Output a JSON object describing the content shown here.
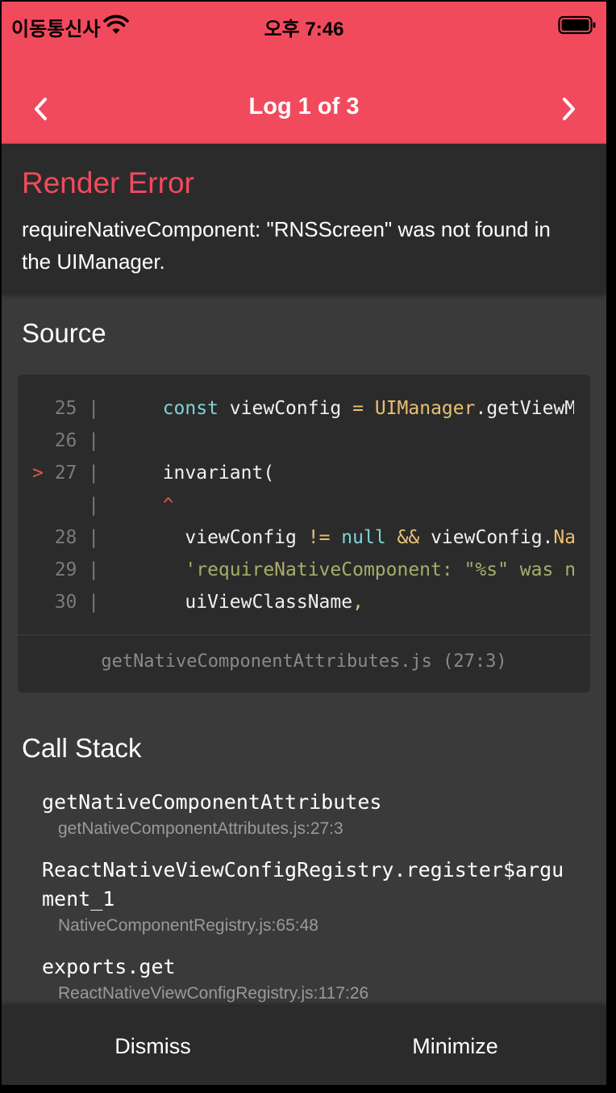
{
  "status_bar": {
    "carrier": "이동통신사",
    "time": "오후 7:46"
  },
  "header": {
    "title": "Log 1 of 3",
    "prev_icon": "chevron-left-icon",
    "next_icon": "chevron-right-icon",
    "color": "#f24a5d"
  },
  "error": {
    "type": "Render Error",
    "message": "requireNativeComponent: \"RNSScreen\" was not found in the UIManager."
  },
  "source": {
    "title": "Source",
    "lines": [
      {
        "gutter": "  25 |",
        "marker": "",
        "code": [
          {
            "t": "  "
          },
          {
            "t": "const",
            "c": "kw"
          },
          {
            "t": " viewConfig "
          },
          {
            "t": "=",
            "c": "fn"
          },
          {
            "t": " "
          },
          {
            "t": "UIManager",
            "c": "fn"
          },
          {
            "t": "."
          },
          {
            "t": "getViewM"
          }
        ]
      },
      {
        "gutter": "  26 |",
        "marker": "",
        "code": []
      },
      {
        "gutter": " 27 |",
        "marker": ">",
        "code": [
          {
            "t": "  invariant("
          }
        ]
      },
      {
        "gutter": "     |",
        "marker": "",
        "code": [
          {
            "t": "  "
          },
          {
            "t": "^",
            "c": "caret"
          }
        ]
      },
      {
        "gutter": "  28 |",
        "marker": "",
        "code": [
          {
            "t": "    viewConfig "
          },
          {
            "t": "!=",
            "c": "fn"
          },
          {
            "t": " "
          },
          {
            "t": "null",
            "c": "kw"
          },
          {
            "t": " "
          },
          {
            "t": "&&",
            "c": "fn"
          },
          {
            "t": " viewConfig."
          },
          {
            "t": "Na",
            "c": "fn"
          }
        ]
      },
      {
        "gutter": "  29 |",
        "marker": "",
        "code": [
          {
            "t": "    "
          },
          {
            "t": "'requireNativeComponent: \"%s\" was no",
            "c": "str"
          }
        ]
      },
      {
        "gutter": "  30 |",
        "marker": "",
        "code": [
          {
            "t": "    uiViewClassName"
          },
          {
            "t": ",",
            "c": "fn"
          }
        ]
      }
    ],
    "file": "getNativeComponentAttributes.js (27:3)"
  },
  "call_stack": {
    "title": "Call Stack",
    "frames": [
      {
        "name": "getNativeComponentAttributes",
        "location": "getNativeComponentAttributes.js:27:3"
      },
      {
        "name": "ReactNativeViewConfigRegistry.register$argument_1",
        "location": "NativeComponentRegistry.js:65:48"
      },
      {
        "name": "exports.get",
        "location": "ReactNativeViewConfigRegistry.js:117:26"
      }
    ]
  },
  "footer": {
    "dismiss": "Dismiss",
    "minimize": "Minimize"
  }
}
